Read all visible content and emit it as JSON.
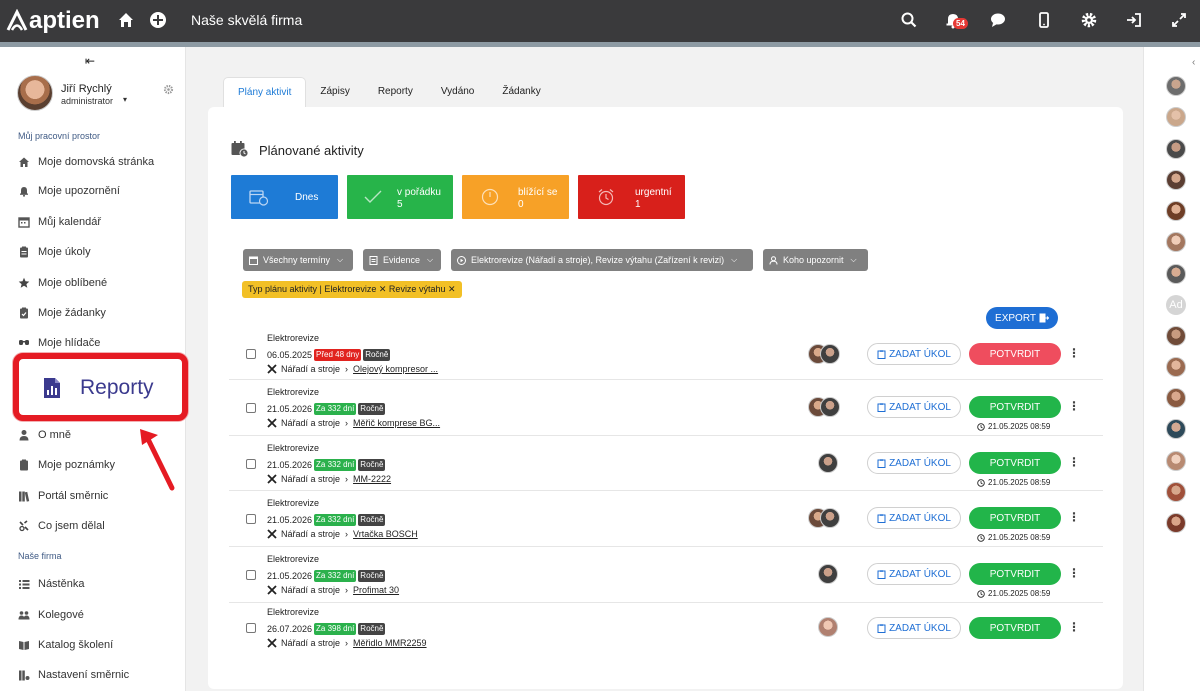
{
  "app": {
    "logo_text": "aptien",
    "company": "Naše skvělá firma",
    "notifications_count": "54"
  },
  "user": {
    "name": "Jiří Rychlý",
    "role": "administrator"
  },
  "sidebar": {
    "section_workspace": "Můj pracovní prostor",
    "section_company": "Naše firma",
    "workspace_items": [
      {
        "label": "Moje domovská stránka",
        "icon": "home-icon"
      },
      {
        "label": "Moje upozornění",
        "icon": "bell-icon"
      },
      {
        "label": "Můj kalendář",
        "icon": "calendar-icon"
      },
      {
        "label": "Moje úkoly",
        "icon": "tasks-icon"
      },
      {
        "label": "Moje oblíbené",
        "icon": "star-icon"
      },
      {
        "label": "Moje žádanky",
        "icon": "requests-icon"
      },
      {
        "label": "Moje hlídače",
        "icon": "eye-icon"
      },
      {
        "label": "O mně",
        "icon": "person-icon"
      },
      {
        "label": "Moje poznámky",
        "icon": "notes-icon"
      },
      {
        "label": "Portál směrnic",
        "icon": "books-icon"
      },
      {
        "label": "Co jsem dělal",
        "icon": "history-icon"
      }
    ],
    "company_items": [
      {
        "label": "Nástěnka",
        "icon": "board-icon"
      },
      {
        "label": "Kolegové",
        "icon": "people-icon"
      },
      {
        "label": "Katalog školení",
        "icon": "catalog-icon"
      },
      {
        "label": "Nastavení směrnic",
        "icon": "settings-books-icon"
      }
    ],
    "highlight_label": "Reporty"
  },
  "tabs": [
    "Plány aktivit",
    "Zápisy",
    "Reporty",
    "Vydáno",
    "Žádanky"
  ],
  "card": {
    "title": "Plánované aktivity",
    "tiles": [
      {
        "label": "Dnes",
        "value": "",
        "color": "#1e7bd6"
      },
      {
        "label": "v pořádku",
        "value": "5",
        "color": "#27b44a"
      },
      {
        "label": "blížící se",
        "value": "0",
        "color": "#f7a127"
      },
      {
        "label": "urgentní",
        "value": "1",
        "color": "#d8201b"
      }
    ],
    "filters": [
      "Všechny termíny",
      "Evidence",
      "Elektrorevize (Nářadí a stroje), Revize výtahu (Zařízení k revizi)",
      "Koho upozornit"
    ],
    "chip": "Typ plánu aktivity | Elektrorevize ✕ Revize výtahu ✕",
    "export_label": "EXPORT",
    "zadat_label": "ZADAT ÚKOL",
    "confirm_label": "POTVRDIT",
    "rows": [
      {
        "type": "Elektrorevize",
        "date": "06.05.2025",
        "badge": "Před 48 dny",
        "badge_color": "red",
        "freq": "Ročně",
        "group": "Nářadí a stroje",
        "item": "Olejový kompresor ...",
        "timestamp": "",
        "confirm_color": "red"
      },
      {
        "type": "Elektrorevize",
        "date": "21.05.2026",
        "badge": "Za 332 dní",
        "badge_color": "green",
        "freq": "Ročně",
        "group": "Nářadí a stroje",
        "item": "Měřič komprese BG...",
        "timestamp": "21.05.2025 08:59",
        "confirm_color": "green"
      },
      {
        "type": "Elektrorevize",
        "date": "21.05.2026",
        "badge": "Za 332 dní",
        "badge_color": "green",
        "freq": "Ročně",
        "group": "Nářadí a stroje",
        "item": "MM-2222",
        "timestamp": "21.05.2025 08:59",
        "confirm_color": "green"
      },
      {
        "type": "Elektrorevize",
        "date": "21.05.2026",
        "badge": "Za 332 dní",
        "badge_color": "green",
        "freq": "Ročně",
        "group": "Nářadí a stroje",
        "item": "Vrtačka BOSCH",
        "timestamp": "21.05.2025 08:59",
        "confirm_color": "green"
      },
      {
        "type": "Elektrorevize",
        "date": "21.05.2026",
        "badge": "Za 332 dní",
        "badge_color": "green",
        "freq": "Ročně",
        "group": "Nářadí a stroje",
        "item": "Profimat 30",
        "timestamp": "21.05.2025 08:59",
        "confirm_color": "green"
      },
      {
        "type": "Elektrorevize",
        "date": "26.07.2026",
        "badge": "Za 398 dní",
        "badge_color": "green",
        "freq": "Ročně",
        "group": "Nářadí a stroje",
        "item": "Měřidlo MMR2259",
        "timestamp": "",
        "confirm_color": "green"
      }
    ]
  },
  "rail": {
    "ad_initials": "Ad"
  }
}
